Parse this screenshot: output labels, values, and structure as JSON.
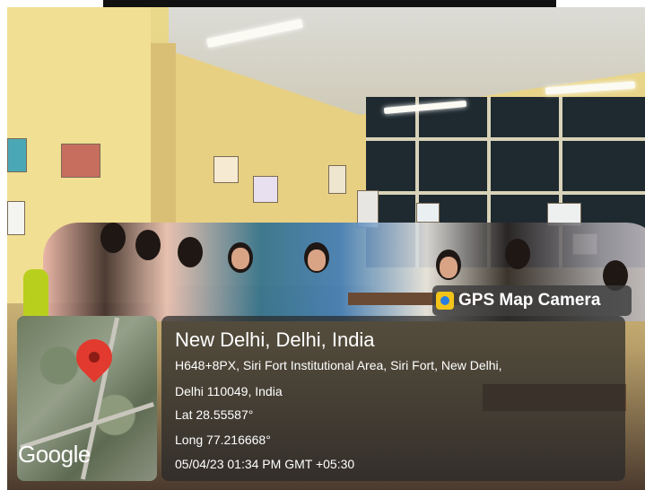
{
  "badge": {
    "label": "GPS Map Camera",
    "icon": "gps-map-camera-icon"
  },
  "location": {
    "title": "New Delhi, Delhi, India",
    "address_line1": "H648+8PX, Siri Fort Institutional Area, Siri Fort, New Delhi,",
    "address_line2": "Delhi 110049, India",
    "lat": "Lat 28.55587°",
    "long": "Long 77.216668°",
    "datetime": "05/04/23 01:34 PM GMT +05:30"
  },
  "map": {
    "attribution": "Google",
    "pin_color": "#e23a2e"
  }
}
